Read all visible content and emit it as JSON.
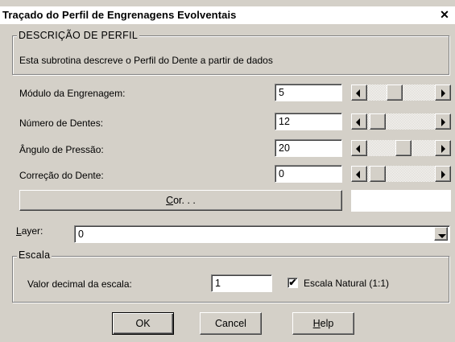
{
  "window": {
    "title": "Traçado do Perfil de Engrenagens Evolventais",
    "close_glyph": "✕"
  },
  "profile_group": {
    "caption": "DESCRIÇÃO DE PERFIL",
    "description": "Esta subrotina descreve o Perfil do Dente a partir de dados"
  },
  "params": [
    {
      "label": "Módulo da Engrenagem:",
      "value": "5",
      "slider_fraction": 0.38
    },
    {
      "label": "Número de Dentes:",
      "value": "12",
      "slider_fraction": 0.05
    },
    {
      "label": "Ângulo de Pressão:",
      "value": "20",
      "slider_fraction": 0.55
    },
    {
      "label": "Correção do Dente:",
      "value": "0",
      "slider_fraction": 0.05
    }
  ],
  "color_button": {
    "label_prefix": "C",
    "label_rest": "or. . ."
  },
  "layer": {
    "label_first": "L",
    "label_rest": "ayer:",
    "value": "0"
  },
  "scale_group": {
    "caption": "Escala",
    "decimal_label": "Valor decimal da escala:",
    "decimal_value": "1",
    "natural_label": "Escala Natural (1:1)",
    "natural_checked": true,
    "check_glyph": "✔"
  },
  "buttons": {
    "ok": "OK",
    "cancel": "Cancel",
    "help_first": "H",
    "help_rest": "elp"
  }
}
